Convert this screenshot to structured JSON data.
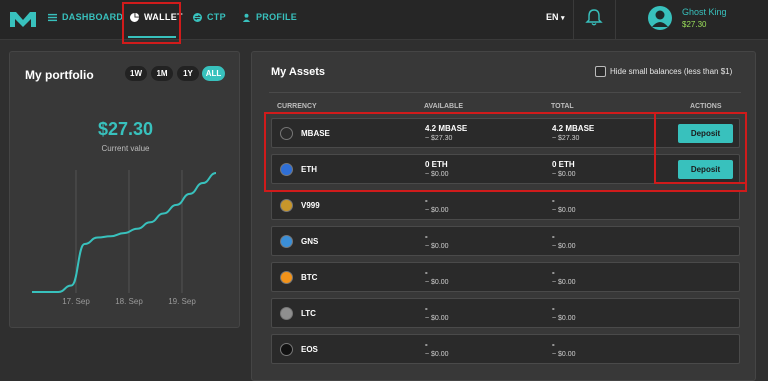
{
  "nav": {
    "dashboard": "DASHBOARD",
    "wallet": "WALLET",
    "ctp": "CTP",
    "profile": "PROFILE",
    "lang": "EN"
  },
  "user": {
    "name": "Ghost King",
    "balance": "$27.30"
  },
  "portfolio": {
    "title": "My portfolio",
    "ranges": [
      "1W",
      "1M",
      "1Y",
      "ALL"
    ],
    "active_range": "ALL",
    "value": "$27.30",
    "caption": "Current value"
  },
  "chart_data": {
    "type": "line",
    "x": [
      "17. Sep",
      "18. Sep",
      "19. Sep"
    ],
    "series": [
      {
        "values": [
          0.0,
          0.0,
          0.0,
          1.5,
          11.0,
          12.5,
          12.8,
          13.5,
          14.5,
          16.0,
          18.0,
          20.0,
          22.5,
          25.0,
          27.3
        ]
      }
    ],
    "xlabel": "",
    "ylabel": ""
  },
  "assets": {
    "title": "My Assets",
    "hide_small": "Hide small balances (less than $1)",
    "columns": {
      "currency": "CURRENCY",
      "available": "AVAILABLE",
      "total": "TOTAL",
      "actions": "ACTIONS"
    },
    "deposit_label": "Deposit",
    "rows": [
      {
        "name": "MBASE",
        "avail": "4.2 MBASE",
        "avail_usd": "~ $27.30",
        "total": "4.2 MBASE",
        "total_usd": "~ $27.30",
        "deposit": true,
        "icon": "mbase-icon",
        "color": "#2b2b2b"
      },
      {
        "name": "ETH",
        "avail": "0 ETH",
        "avail_usd": "~ $0.00",
        "total": "0 ETH",
        "total_usd": "~ $0.00",
        "deposit": true,
        "icon": "eth-icon",
        "color": "#2f6fd6"
      },
      {
        "name": "V999",
        "avail": "-",
        "avail_usd": "~ $0.00",
        "total": "-",
        "total_usd": "~ $0.00",
        "deposit": false,
        "icon": "v999-icon",
        "color": "#c8962a"
      },
      {
        "name": "GNS",
        "avail": "-",
        "avail_usd": "~ $0.00",
        "total": "-",
        "total_usd": "~ $0.00",
        "deposit": false,
        "icon": "gns-icon",
        "color": "#3b8fd8"
      },
      {
        "name": "BTC",
        "avail": "-",
        "avail_usd": "~ $0.00",
        "total": "-",
        "total_usd": "~ $0.00",
        "deposit": false,
        "icon": "btc-icon",
        "color": "#f2931a"
      },
      {
        "name": "LTC",
        "avail": "-",
        "avail_usd": "~ $0.00",
        "total": "-",
        "total_usd": "~ $0.00",
        "deposit": false,
        "icon": "ltc-icon",
        "color": "#8f8f8f"
      },
      {
        "name": "EOS",
        "avail": "-",
        "avail_usd": "~ $0.00",
        "total": "-",
        "total_usd": "~ $0.00",
        "deposit": false,
        "icon": "eos-icon",
        "color": "#111111"
      }
    ]
  }
}
